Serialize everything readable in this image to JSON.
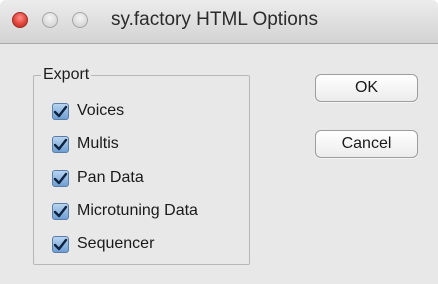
{
  "window": {
    "title": "sy.factory HTML Options"
  },
  "export_group": {
    "label": "Export",
    "options": [
      {
        "label": "Voices",
        "checked": true
      },
      {
        "label": "Multis",
        "checked": true
      },
      {
        "label": "Pan Data",
        "checked": true
      },
      {
        "label": "Microtuning Data",
        "checked": true
      },
      {
        "label": "Sequencer",
        "checked": true
      }
    ]
  },
  "buttons": {
    "ok_label": "OK",
    "cancel_label": "Cancel"
  },
  "colors": {
    "close": "#e0443b",
    "checkbox_accent": "#6f9fd3"
  }
}
